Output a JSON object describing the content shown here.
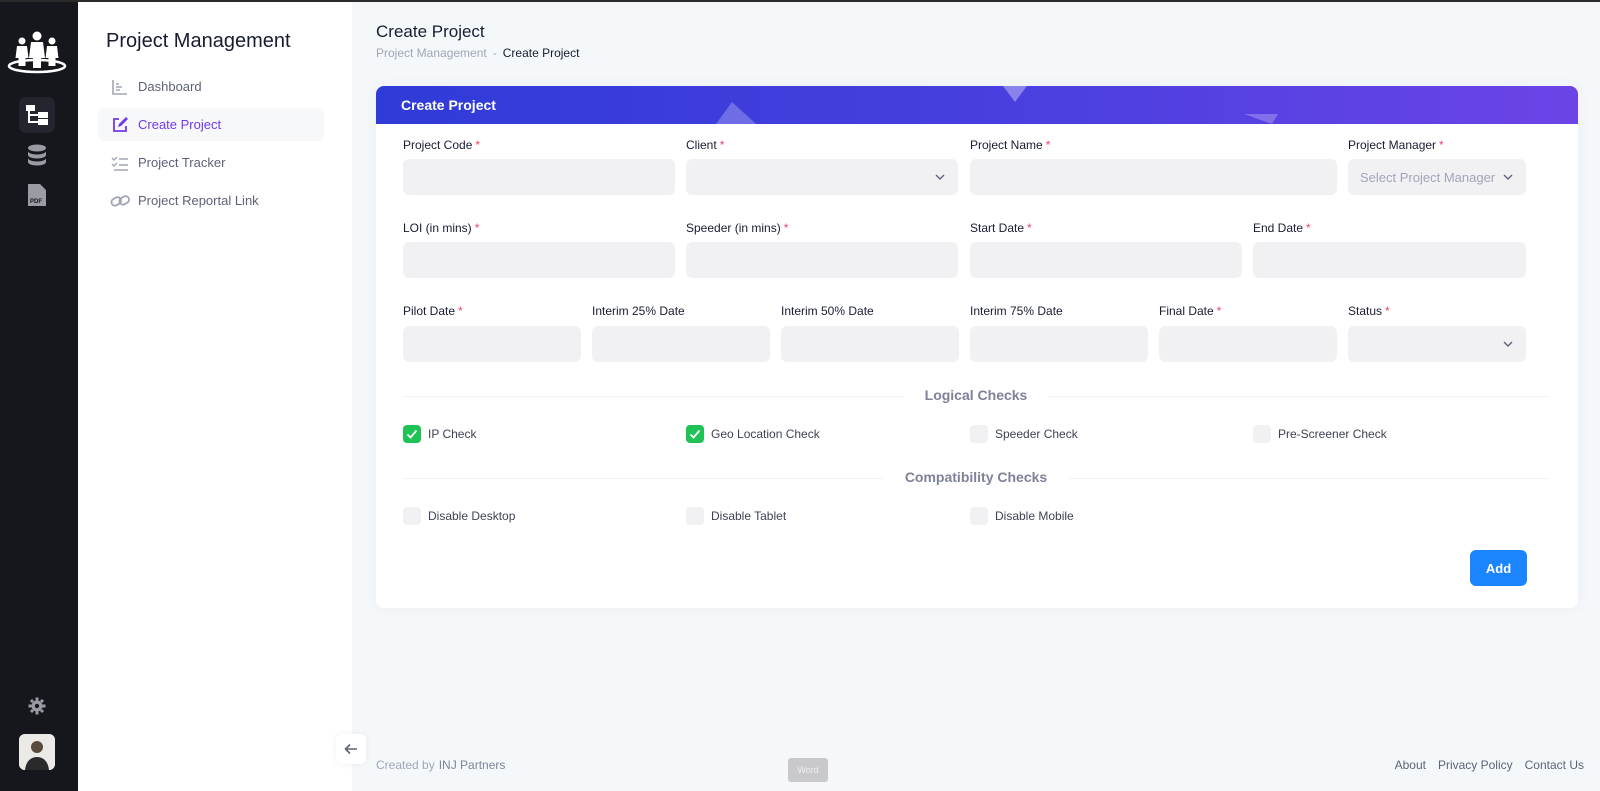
{
  "sidebar": {
    "title": "Project Management",
    "items": [
      {
        "label": "Dashboard",
        "icon": "chart-icon"
      },
      {
        "label": "Create Project",
        "icon": "edit-icon"
      },
      {
        "label": "Project Tracker",
        "icon": "checklist-icon"
      },
      {
        "label": "Project Reportal Link",
        "icon": "link-icon"
      }
    ]
  },
  "rail": {
    "items": [
      "hierarchy-icon",
      "database-icon",
      "pdf-icon"
    ],
    "settings_icon": "gear-icon"
  },
  "header": {
    "title": "Create Project",
    "breadcrumb": {
      "parent": "Project Management",
      "separator": "-",
      "current": "Create Project"
    }
  },
  "card": {
    "title": "Create Project"
  },
  "form": {
    "project_code": {
      "label": "Project Code",
      "value": ""
    },
    "client": {
      "label": "Client",
      "value": ""
    },
    "project_name": {
      "label": "Project Name",
      "value": ""
    },
    "project_manager": {
      "label": "Project Manager",
      "placeholder": "Select Project Manager"
    },
    "loi": {
      "label": "LOI (in mins)",
      "value": ""
    },
    "speeder": {
      "label": "Speeder (in mins)",
      "value": ""
    },
    "start_date": {
      "label": "Start Date",
      "value": ""
    },
    "end_date": {
      "label": "End Date",
      "value": ""
    },
    "pilot_date": {
      "label": "Pilot Date",
      "value": ""
    },
    "interim25": {
      "label": "Interim 25% Date",
      "value": ""
    },
    "interim50": {
      "label": "Interim 50% Date",
      "value": ""
    },
    "interim75": {
      "label": "Interim 75% Date",
      "value": ""
    },
    "final_date": {
      "label": "Final Date",
      "value": ""
    },
    "status": {
      "label": "Status",
      "value": ""
    },
    "required_mark": "*"
  },
  "logical_checks": {
    "title": "Logical Checks",
    "items": [
      {
        "label": "IP Check",
        "checked": true
      },
      {
        "label": "Geo Location Check",
        "checked": true
      },
      {
        "label": "Speeder Check",
        "checked": false
      },
      {
        "label": "Pre-Screener Check",
        "checked": false
      }
    ]
  },
  "compat_checks": {
    "title": "Compatibility Checks",
    "items": [
      {
        "label": "Disable Desktop",
        "checked": false
      },
      {
        "label": "Disable Tablet",
        "checked": false
      },
      {
        "label": "Disable Mobile",
        "checked": false
      }
    ]
  },
  "actions": {
    "add_label": "Add"
  },
  "footer": {
    "created_by": "Created by",
    "company": "INJ Partners",
    "word_badge": "Word",
    "links": [
      "About",
      "Privacy Policy",
      "Contact Us"
    ]
  },
  "colors": {
    "accent": "#7239ea",
    "primary": "#1b84ff",
    "success": "#1fc254",
    "required": "#f1416c"
  }
}
